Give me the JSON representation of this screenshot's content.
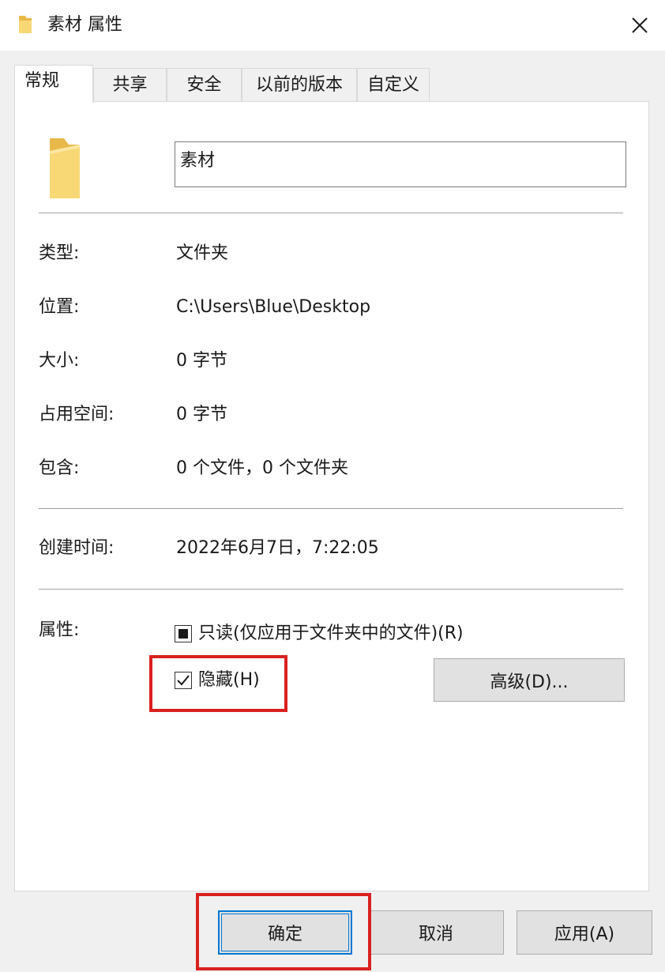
{
  "window": {
    "title": "素材 属性"
  },
  "tabs": [
    {
      "label": "常规"
    },
    {
      "label": "共享"
    },
    {
      "label": "安全"
    },
    {
      "label": "以前的版本"
    },
    {
      "label": "自定义"
    }
  ],
  "general": {
    "folder_name": "素材",
    "properties": [
      {
        "label": "类型:",
        "value": "文件夹"
      },
      {
        "label": "位置:",
        "value": "C:\\Users\\Blue\\Desktop"
      },
      {
        "label": "大小:",
        "value": "0 字节"
      },
      {
        "label": "占用空间:",
        "value": "0 字节"
      },
      {
        "label": "包含:",
        "value": "0 个文件，0 个文件夹"
      }
    ],
    "created": {
      "label": "创建时间:",
      "value": "2022年6月7日，7:22:05"
    },
    "attributes": {
      "label": "属性:",
      "readonly_label": "只读(仅应用于文件夹中的文件)(R)",
      "readonly_state": "indeterminate",
      "hidden_label": "隐藏(H)",
      "hidden_state": "checked",
      "advanced_button": "高级(D)..."
    }
  },
  "footer": {
    "ok": "确定",
    "cancel": "取消",
    "apply": "应用(A)"
  },
  "colors": {
    "highlight": "#d9211f",
    "focus": "#0078d7",
    "folder": "#f8d775"
  }
}
